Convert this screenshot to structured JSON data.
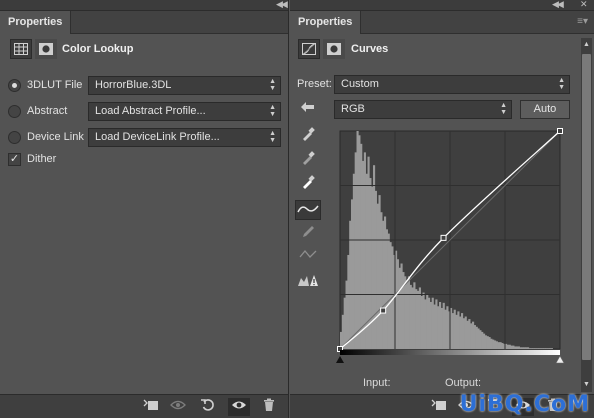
{
  "left_panel": {
    "tab_label": "Properties",
    "title": "Color Lookup",
    "options": [
      {
        "label": "3DLUT File",
        "value": "HorrorBlue.3DL",
        "selected": true
      },
      {
        "label": "Abstract",
        "value": "Load Abstract Profile...",
        "selected": false
      },
      {
        "label": "Device Link",
        "value": "Load DeviceLink Profile...",
        "selected": false
      }
    ],
    "dither_label": "Dither",
    "dither_checked": true
  },
  "right_panel": {
    "tab_label": "Properties",
    "title": "Curves",
    "preset_label": "Preset:",
    "preset_value": "Custom",
    "channel_value": "RGB",
    "auto_label": "Auto",
    "input_label": "Input:",
    "output_label": "Output:"
  },
  "chart_data": {
    "type": "line",
    "title": "",
    "xlabel": "Input:",
    "ylabel": "Output:",
    "xlim": [
      0,
      255
    ],
    "ylim": [
      0,
      255
    ],
    "grid": true,
    "series": [
      {
        "x": [
          0,
          50,
          120,
          255
        ],
        "values": [
          0,
          45,
          130,
          255
        ]
      }
    ],
    "histogram": [
      20,
      40,
      60,
      80,
      110,
      150,
      175,
      205,
      230,
      255,
      250,
      240,
      220,
      230,
      205,
      225,
      200,
      190,
      215,
      185,
      170,
      180,
      160,
      150,
      155,
      140,
      135,
      125,
      120,
      110,
      115,
      105,
      95,
      100,
      90,
      85,
      80,
      85,
      75,
      72,
      78,
      70,
      68,
      72,
      62,
      66,
      58,
      64,
      60,
      55,
      60,
      52,
      58,
      50,
      55,
      48,
      54,
      46,
      50,
      44,
      48,
      42,
      46,
      40,
      44,
      38,
      42,
      36,
      38,
      33,
      35,
      30,
      32,
      28,
      26,
      24,
      22,
      20,
      18,
      16,
      15,
      14,
      12,
      11,
      10,
      9,
      8,
      8,
      7,
      6,
      6,
      5,
      5,
      4,
      4,
      3,
      3,
      3,
      2,
      2,
      2,
      2,
      2,
      1,
      1,
      1,
      1,
      1,
      1,
      1,
      1,
      1,
      1,
      1,
      1,
      1,
      0,
      0,
      0,
      0
    ]
  },
  "watermark": "UiBQ.CoM",
  "colors": {
    "panel_bg": "#535353",
    "graph_bg": "#3f3f3f",
    "histogram": "#9a9a9a",
    "curve": "#ffffff",
    "watermark": "#2d6fd6"
  },
  "icons": {
    "left_bottom": [
      "clip-to-layer-icon",
      "view-previous-state-icon",
      "reset-icon",
      "visibility-eye-icon",
      "trash-icon"
    ],
    "right_bottom": [
      "clip-to-layer-icon",
      "view-previous-state-icon",
      "reset-icon",
      "visibility-eye-icon",
      "trash-icon"
    ],
    "tools": [
      "on-image-adjust-icon",
      "black-point-eyedropper-icon",
      "gray-point-eyedropper-icon",
      "white-point-eyedropper-icon",
      "curve-point-tool-icon",
      "pencil-draw-icon",
      "smooth-curve-icon",
      "clipping-warning-icon"
    ]
  }
}
